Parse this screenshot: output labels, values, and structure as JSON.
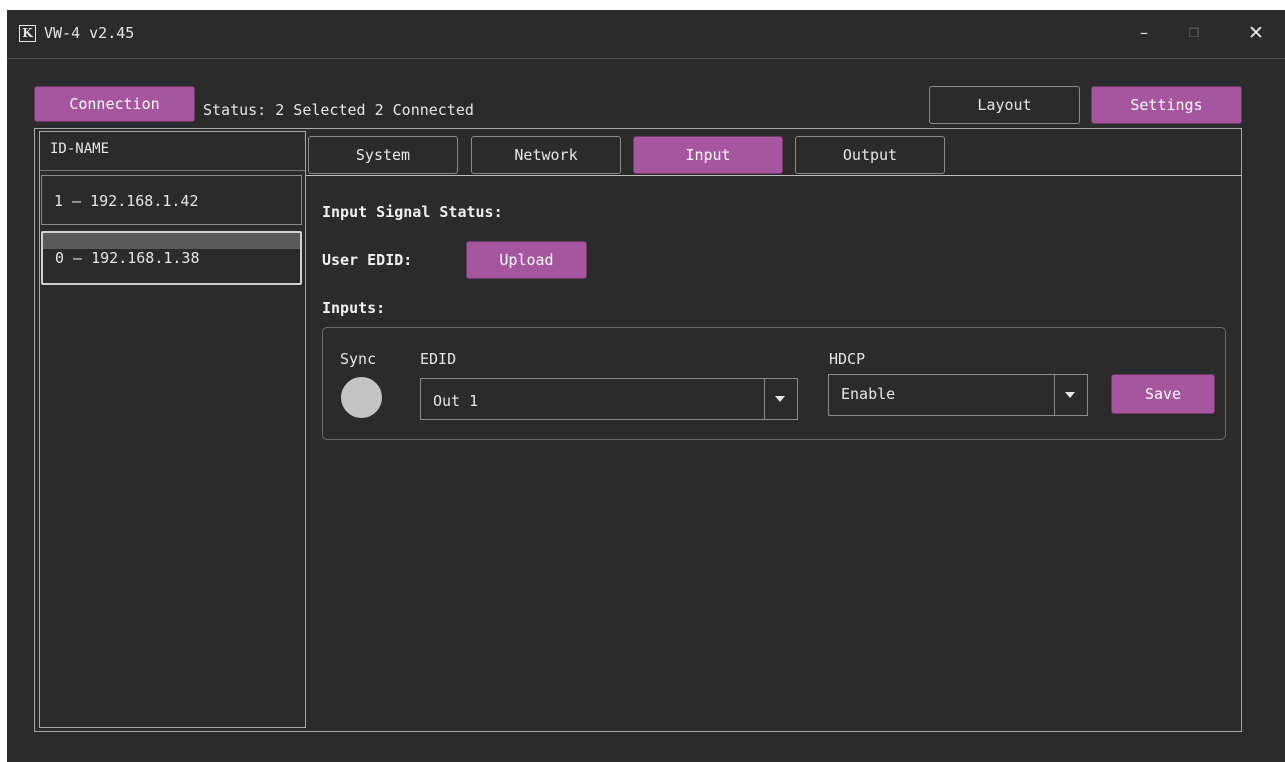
{
  "window": {
    "title": "VW-4 v2.45",
    "logo_letter": "K",
    "minimize_glyph": "–",
    "maximize_glyph": "❐",
    "close_glyph": "✕"
  },
  "toolbar": {
    "connection_label": "Connection",
    "status_text": "Status: 2 Selected 2 Connected",
    "layout_label": "Layout",
    "settings_label": "Settings"
  },
  "device_list": {
    "header": "ID-NAME",
    "items": [
      {
        "label": "1 – 192.168.1.42",
        "selected": false
      },
      {
        "label": "0 – 192.168.1.38",
        "selected": true
      }
    ]
  },
  "tabs": [
    {
      "label": "System",
      "active": false
    },
    {
      "label": "Network",
      "active": false
    },
    {
      "label": "Input",
      "active": true
    },
    {
      "label": "Output",
      "active": false
    }
  ],
  "input_page": {
    "signal_status_label": "Input Signal Status:",
    "user_edid_label": "User EDID:",
    "upload_label": "Upload",
    "inputs_label": "Inputs:",
    "sync_label": "Sync",
    "edid_label": "EDID",
    "hdcp_label": "HDCP",
    "edid_value": "Out 1",
    "hdcp_value": "Enable",
    "save_label": "Save",
    "sync_state": "inactive"
  },
  "colors": {
    "accent": "#a5569f",
    "background": "#2b2b2b",
    "sync_indicator": "#c4c4c4"
  }
}
